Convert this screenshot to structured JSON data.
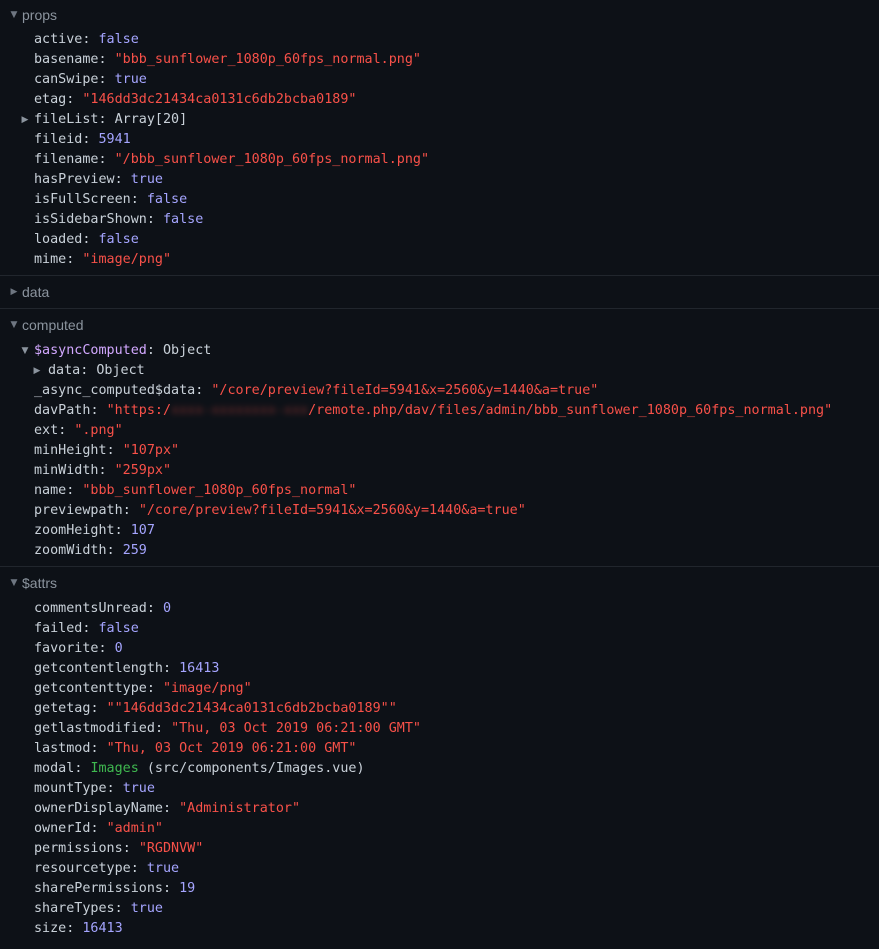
{
  "sections": {
    "props": {
      "title": "props"
    },
    "data": {
      "title": "data"
    },
    "computed": {
      "title": "computed"
    },
    "attrs": {
      "title": "$attrs"
    }
  },
  "props": [
    {
      "key": "active",
      "val": "false",
      "type": "bool"
    },
    {
      "key": "basename",
      "val": "\"bbb_sunflower_1080p_60fps_normal.png\"",
      "type": "str"
    },
    {
      "key": "canSwipe",
      "val": "true",
      "type": "bool"
    },
    {
      "key": "etag",
      "val": "\"146dd3dc21434ca0131c6db2bcba0189\"",
      "type": "str"
    },
    {
      "key": "fileList",
      "val": "Array[20]",
      "type": "plain",
      "expand": true
    },
    {
      "key": "fileid",
      "val": "5941",
      "type": "num"
    },
    {
      "key": "filename",
      "val": "\"/bbb_sunflower_1080p_60fps_normal.png\"",
      "type": "str"
    },
    {
      "key": "hasPreview",
      "val": "true",
      "type": "bool"
    },
    {
      "key": "isFullScreen",
      "val": "false",
      "type": "bool"
    },
    {
      "key": "isSidebarShown",
      "val": "false",
      "type": "bool"
    },
    {
      "key": "loaded",
      "val": "false",
      "type": "bool"
    },
    {
      "key": "mime",
      "val": "\"image/png\"",
      "type": "str"
    }
  ],
  "computed": {
    "asyncComputed": {
      "key": "$asyncComputed",
      "val": "Object"
    },
    "asyncData": {
      "key": "data",
      "val": "Object"
    },
    "async_computed_data": {
      "key": "_async_computed$data",
      "val": "\"/core/preview?fileId=5941&x=2560&y=1440&a=true\""
    },
    "davPath": {
      "key": "davPath",
      "val_prefix": "\"https:/",
      "val_suffix": "/remote.php/dav/files/admin/bbb_sunflower_1080p_60fps_normal.png\""
    },
    "rows": [
      {
        "key": "ext",
        "val": "\".png\"",
        "type": "str"
      },
      {
        "key": "minHeight",
        "val": "\"107px\"",
        "type": "str"
      },
      {
        "key": "minWidth",
        "val": "\"259px\"",
        "type": "str"
      },
      {
        "key": "name",
        "val": "\"bbb_sunflower_1080p_60fps_normal\"",
        "type": "str"
      },
      {
        "key": "previewpath",
        "val": "\"/core/preview?fileId=5941&x=2560&y=1440&a=true\"",
        "type": "str"
      },
      {
        "key": "zoomHeight",
        "val": "107",
        "type": "num"
      },
      {
        "key": "zoomWidth",
        "val": "259",
        "type": "num"
      }
    ]
  },
  "attrs": [
    {
      "key": "commentsUnread",
      "val": "0",
      "type": "num"
    },
    {
      "key": "failed",
      "val": "false",
      "type": "bool"
    },
    {
      "key": "favorite",
      "val": "0",
      "type": "num"
    },
    {
      "key": "getcontentlength",
      "val": "16413",
      "type": "num"
    },
    {
      "key": "getcontenttype",
      "val": "\"image/png\"",
      "type": "str"
    },
    {
      "key": "getetag",
      "val": "\"\"146dd3dc21434ca0131c6db2bcba0189\"\"",
      "type": "str"
    },
    {
      "key": "getlastmodified",
      "val": "\"Thu, 03 Oct 2019 06:21:00 GMT\"",
      "type": "str"
    },
    {
      "key": "lastmod",
      "val": "\"Thu, 03 Oct 2019 06:21:00 GMT\"",
      "type": "str"
    },
    {
      "key": "modal",
      "val": "Images",
      "suffix": " (src/components/Images.vue)",
      "type": "comp"
    },
    {
      "key": "mountType",
      "val": "true",
      "type": "bool"
    },
    {
      "key": "ownerDisplayName",
      "val": "\"Administrator\"",
      "type": "str"
    },
    {
      "key": "ownerId",
      "val": "\"admin\"",
      "type": "str"
    },
    {
      "key": "permissions",
      "val": "\"RGDNVW\"",
      "type": "str"
    },
    {
      "key": "resourcetype",
      "val": "true",
      "type": "bool"
    },
    {
      "key": "sharePermissions",
      "val": "19",
      "type": "num"
    },
    {
      "key": "shareTypes",
      "val": "true",
      "type": "bool"
    },
    {
      "key": "size",
      "val": "16413",
      "type": "num"
    }
  ]
}
